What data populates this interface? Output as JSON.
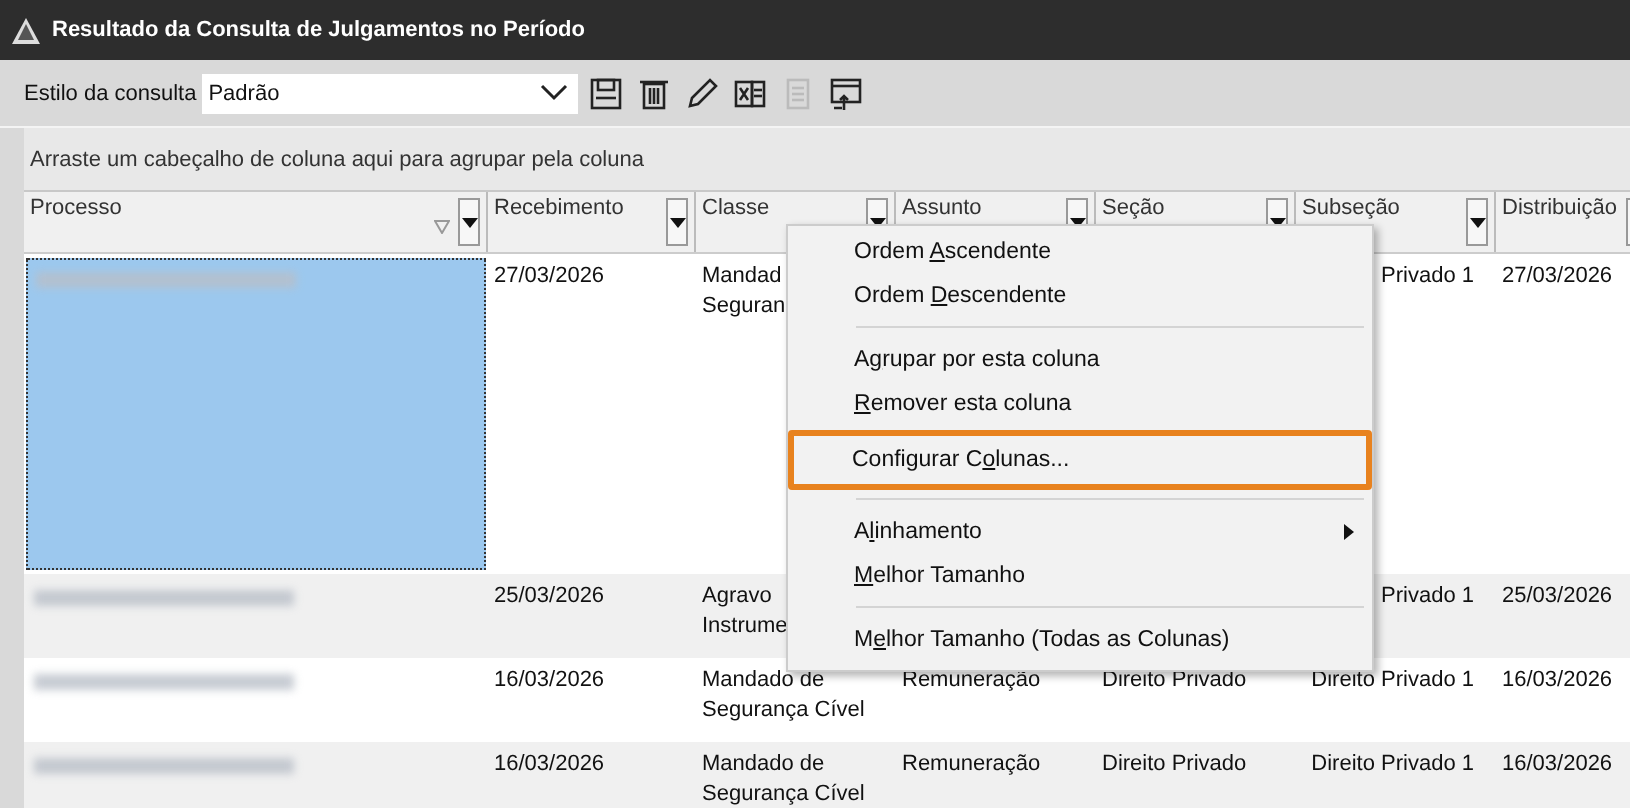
{
  "window": {
    "title": "Resultado da Consulta de Julgamentos no Período"
  },
  "toolbar": {
    "style_label": "Estilo da consulta",
    "style_value": "Padrão",
    "tools": [
      {
        "kind": "save",
        "disabled": false
      },
      {
        "kind": "delete",
        "disabled": false
      },
      {
        "kind": "edit",
        "disabled": false
      },
      {
        "kind": "export",
        "disabled": false
      },
      {
        "kind": "copy",
        "disabled": true
      },
      {
        "kind": "window",
        "disabled": false
      }
    ]
  },
  "group_panel": {
    "hint": "Arraste um cabeçalho de coluna aqui para agrupar pela coluna"
  },
  "table": {
    "columns": [
      {
        "label": "Processo",
        "filtered": true
      },
      {
        "label": "Recebimento",
        "filtered": false
      },
      {
        "label": "Classe",
        "filtered": false
      },
      {
        "label": "Assunto",
        "filtered": false
      },
      {
        "label": "Seção",
        "filtered": false
      },
      {
        "label": "Subseção",
        "filtered": false
      },
      {
        "label": "Distribuição",
        "filtered": false
      }
    ],
    "rows": [
      {
        "selected": true,
        "cells": [
          "",
          "27/03/2026",
          "Mandad\nSeguran",
          "",
          "",
          "Privado 1",
          "27/03/2026"
        ]
      },
      {
        "selected": false,
        "cells": [
          "",
          "25/03/2026",
          "Agravo\nInstrume",
          "",
          "",
          "Privado 1",
          "25/03/2026"
        ]
      },
      {
        "selected": false,
        "cells": [
          "",
          "16/03/2026",
          "Mandado de\nSegurança Cível",
          "Remuneração",
          "Direito Privado",
          "Direito Privado 1",
          "16/03/2026"
        ]
      },
      {
        "selected": false,
        "cells": [
          "",
          "16/03/2026",
          "Mandado de\nSegurança Cível",
          "Remuneração",
          "Direito Privado",
          "Direito Privado 1",
          "16/03/2026"
        ]
      }
    ]
  },
  "context_menu": {
    "items": [
      {
        "kind": "item",
        "before": "Ordem ",
        "key": "A",
        "after": "scendente",
        "selected": false,
        "submenu": false
      },
      {
        "kind": "item",
        "before": "Ordem ",
        "key": "D",
        "after": "escendente",
        "selected": false,
        "submenu": false
      },
      {
        "kind": "separator"
      },
      {
        "kind": "item",
        "before": "A",
        "key": "g",
        "after": "rupar por esta coluna",
        "selected": false,
        "submenu": false
      },
      {
        "kind": "item",
        "key": "R",
        "after": "emover esta coluna",
        "selected": false,
        "submenu": false
      },
      {
        "kind": "item",
        "before": "Configurar C",
        "key": "o",
        "after": "lunas...",
        "selected": true,
        "submenu": false
      },
      {
        "kind": "separator"
      },
      {
        "kind": "item",
        "before": "A",
        "key": "l",
        "after": "inhamento",
        "selected": false,
        "submenu": true
      },
      {
        "kind": "item",
        "key": "M",
        "after": "elhor Tamanho",
        "selected": false,
        "submenu": false
      },
      {
        "kind": "separator"
      },
      {
        "kind": "item",
        "before": "M",
        "key": "e",
        "after": "lhor Tamanho (Todas as Colunas)",
        "selected": false,
        "submenu": false
      }
    ]
  }
}
